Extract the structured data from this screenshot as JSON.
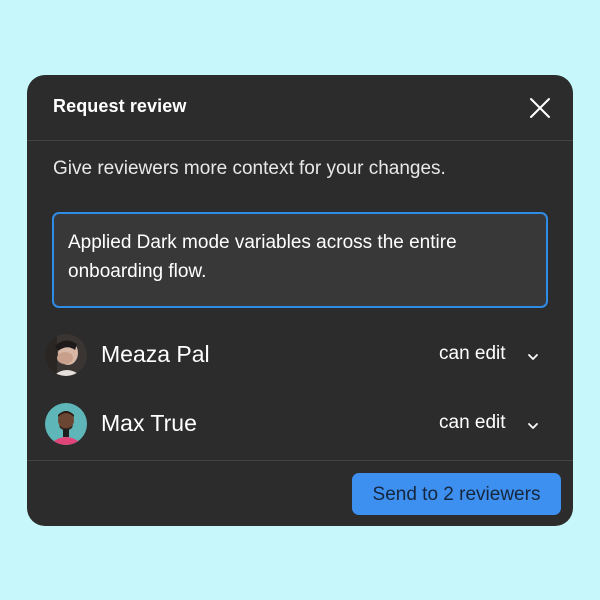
{
  "dialog": {
    "title": "Request review",
    "subtitle": "Give reviewers more context for your changes.",
    "message": "Applied Dark mode variables across the entire onboarding flow.",
    "close_icon": "close-icon"
  },
  "reviewers": [
    {
      "name": "Meaza Pal",
      "permission": "can edit",
      "avatar_icon": "avatar-photo"
    },
    {
      "name": "Max True",
      "permission": "can edit",
      "avatar_icon": "avatar-photo"
    }
  ],
  "footer": {
    "send_label": "Send to 2 reviewers"
  },
  "colors": {
    "background": "#c8f7fb",
    "dialog": "#2c2c2c",
    "accent": "#3d8ff0",
    "focus_border": "#2d8ce8"
  }
}
